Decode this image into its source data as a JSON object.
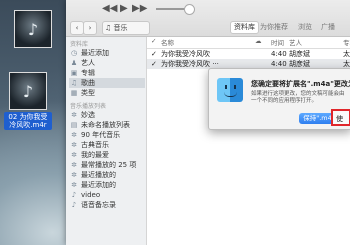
{
  "desktop": {
    "file1_caption": "",
    "file2_caption": "02 为你我受冷风吹.m4r"
  },
  "toolbar": {
    "prev": "◀◀",
    "play": "▶",
    "next": "▶▶",
    "category": "♫ 音乐",
    "tab_library": "资料库",
    "tab_foryou": "为你推荐",
    "tab_browse": "浏览",
    "tab_radio": "广播"
  },
  "sidebar": {
    "library_title": "资料库",
    "library_items": [
      {
        "icon": "◷",
        "label": "最近添加"
      },
      {
        "icon": "♟",
        "label": "艺人"
      },
      {
        "icon": "▣",
        "label": "专辑"
      },
      {
        "icon": "♫",
        "label": "歌曲"
      },
      {
        "icon": "▦",
        "label": "类型"
      }
    ],
    "playlist_title": "音乐播放列表",
    "playlist_items": [
      {
        "icon": "✲",
        "label": "妙选"
      },
      {
        "icon": "▤",
        "label": "未命名播放列表"
      },
      {
        "icon": "✲",
        "label": "90 年代音乐"
      },
      {
        "icon": "✲",
        "label": "古典音乐"
      },
      {
        "icon": "✲",
        "label": "我的最爱"
      },
      {
        "icon": "✲",
        "label": "最常播放的 25 项"
      },
      {
        "icon": "✲",
        "label": "最近播放的"
      },
      {
        "icon": "✲",
        "label": "最近添加的"
      },
      {
        "icon": "♪",
        "label": "video"
      },
      {
        "icon": "♪",
        "label": "语音备忘录"
      }
    ]
  },
  "table": {
    "headers": {
      "check": "✓",
      "name": "名称",
      "cloud": "☁",
      "time": "时间",
      "artist": "艺人",
      "album": "专辑"
    },
    "rows": [
      {
        "check": "✓",
        "name": "为你我受冷风吹",
        "time": "4:40",
        "artist": "胡彦斌",
        "album": "太"
      },
      {
        "check": "✓",
        "name": "为你我受冷风吹 ···",
        "time": "4:40",
        "artist": "胡彦斌",
        "album": "太"
      }
    ]
  },
  "dialog": {
    "title": "您确定要将扩展名\".m4a\"更改为\".m4r\"吗？",
    "message": "如果进行这项更改，您的文稿可能会由一个不同的应用程序打开。",
    "keep_button": "保持\".m4a\"",
    "use_button": "使"
  },
  "colors": {
    "accent": "#2f7ff0",
    "highlight_border": "#e0262b"
  }
}
